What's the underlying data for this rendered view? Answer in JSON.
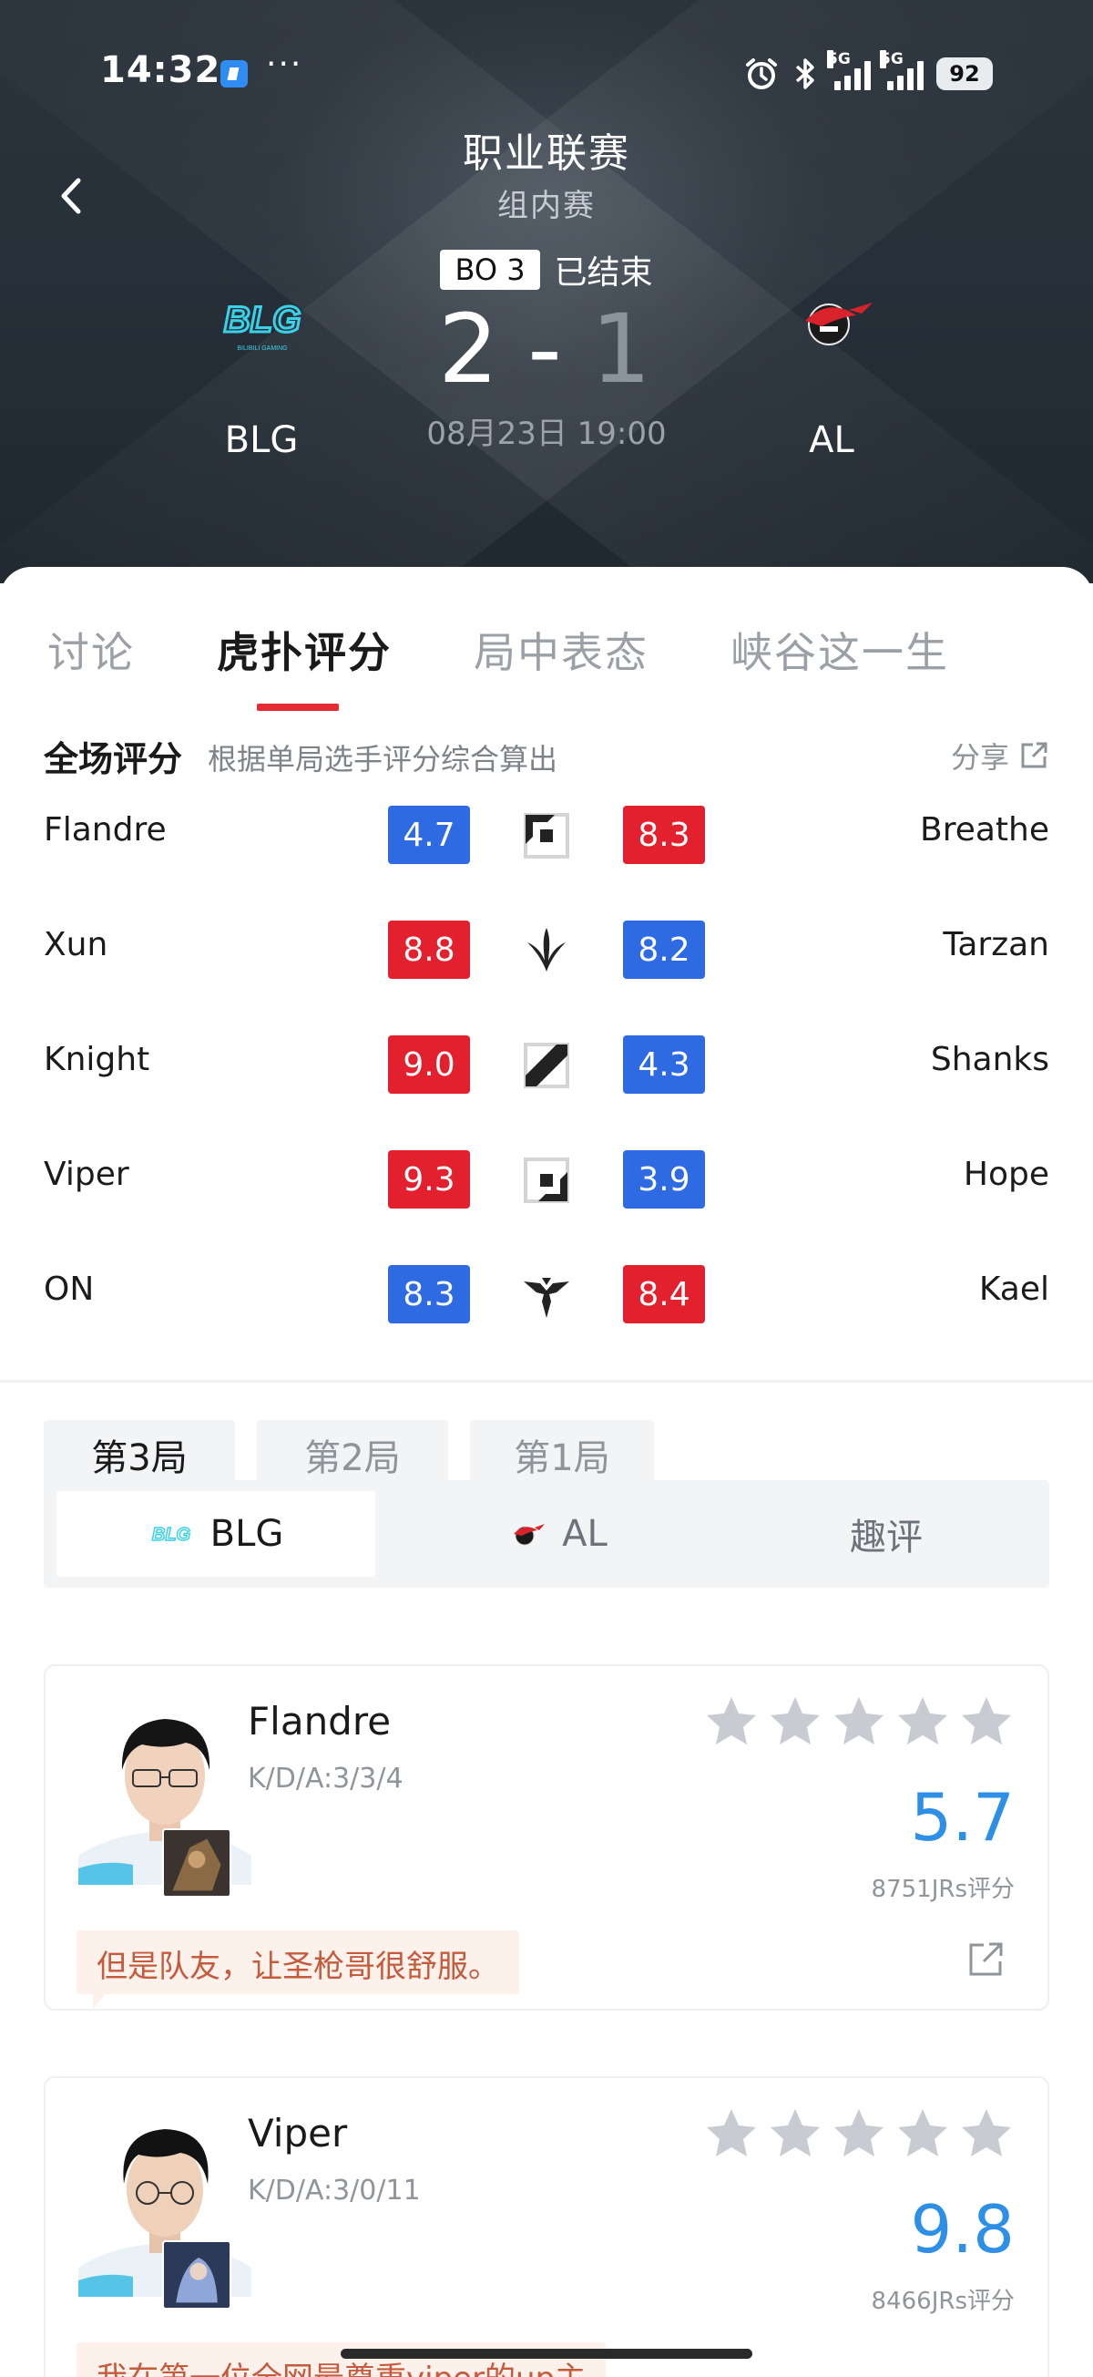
{
  "status_bar": {
    "time": "14:32",
    "dots": "···",
    "battery": "92",
    "network": "5G"
  },
  "header": {
    "league": "职业联赛",
    "stage": "组内赛",
    "format": "BO 3",
    "status": "已结束",
    "score_left": "2",
    "score_sep": "-",
    "score_right": "1",
    "datetime": "08月23日 19:00",
    "team_left": "BLG",
    "team_right": "AL",
    "blg_logo_sub": "BILIBILI GAMING"
  },
  "tabs": [
    "讨论",
    "虎扑评分",
    "局中表态",
    "峡谷这一生"
  ],
  "rating": {
    "title": "全场评分",
    "subtitle": "根据单局选手评分综合算出",
    "share": "分享",
    "rows": [
      {
        "left_player": "Flandre",
        "left_score": "4.7",
        "left_color": "blue",
        "right_score": "8.3",
        "right_color": "red",
        "right_player": "Breathe",
        "role": "top-icon"
      },
      {
        "left_player": "Xun",
        "left_score": "8.8",
        "left_color": "red",
        "right_score": "8.2",
        "right_color": "blue",
        "right_player": "Tarzan",
        "role": "jungle-icon"
      },
      {
        "left_player": "Knight",
        "left_score": "9.0",
        "left_color": "red",
        "right_score": "4.3",
        "right_color": "blue",
        "right_player": "Shanks",
        "role": "mid-icon"
      },
      {
        "left_player": "Viper",
        "left_score": "9.3",
        "left_color": "red",
        "right_score": "3.9",
        "right_color": "blue",
        "right_player": "Hope",
        "role": "bot-icon"
      },
      {
        "left_player": "ON",
        "left_score": "8.3",
        "left_color": "blue",
        "right_score": "8.4",
        "right_color": "red",
        "right_player": "Kael",
        "role": "support-icon"
      }
    ]
  },
  "games": [
    "第3局",
    "第2局",
    "第1局"
  ],
  "team_tabs": {
    "blg": "BLG",
    "al": "AL",
    "fun": "趣评"
  },
  "players": [
    {
      "name": "Flandre",
      "kda": "K/D/A:3/3/4",
      "rating": "5.7",
      "votes": "8751JRs评分",
      "comment": "但是队友，让圣枪哥很舒服。"
    },
    {
      "name": "Viper",
      "kda": "K/D/A:3/0/11",
      "rating": "9.8",
      "votes": "8466JRs评分",
      "comment": "我在第一位全网最尊重viper的up主"
    }
  ],
  "colors": {
    "red": "#e3202e",
    "blue": "#2e6be2",
    "accent": "#e52b36",
    "rating_blue": "#2d8fe6"
  }
}
